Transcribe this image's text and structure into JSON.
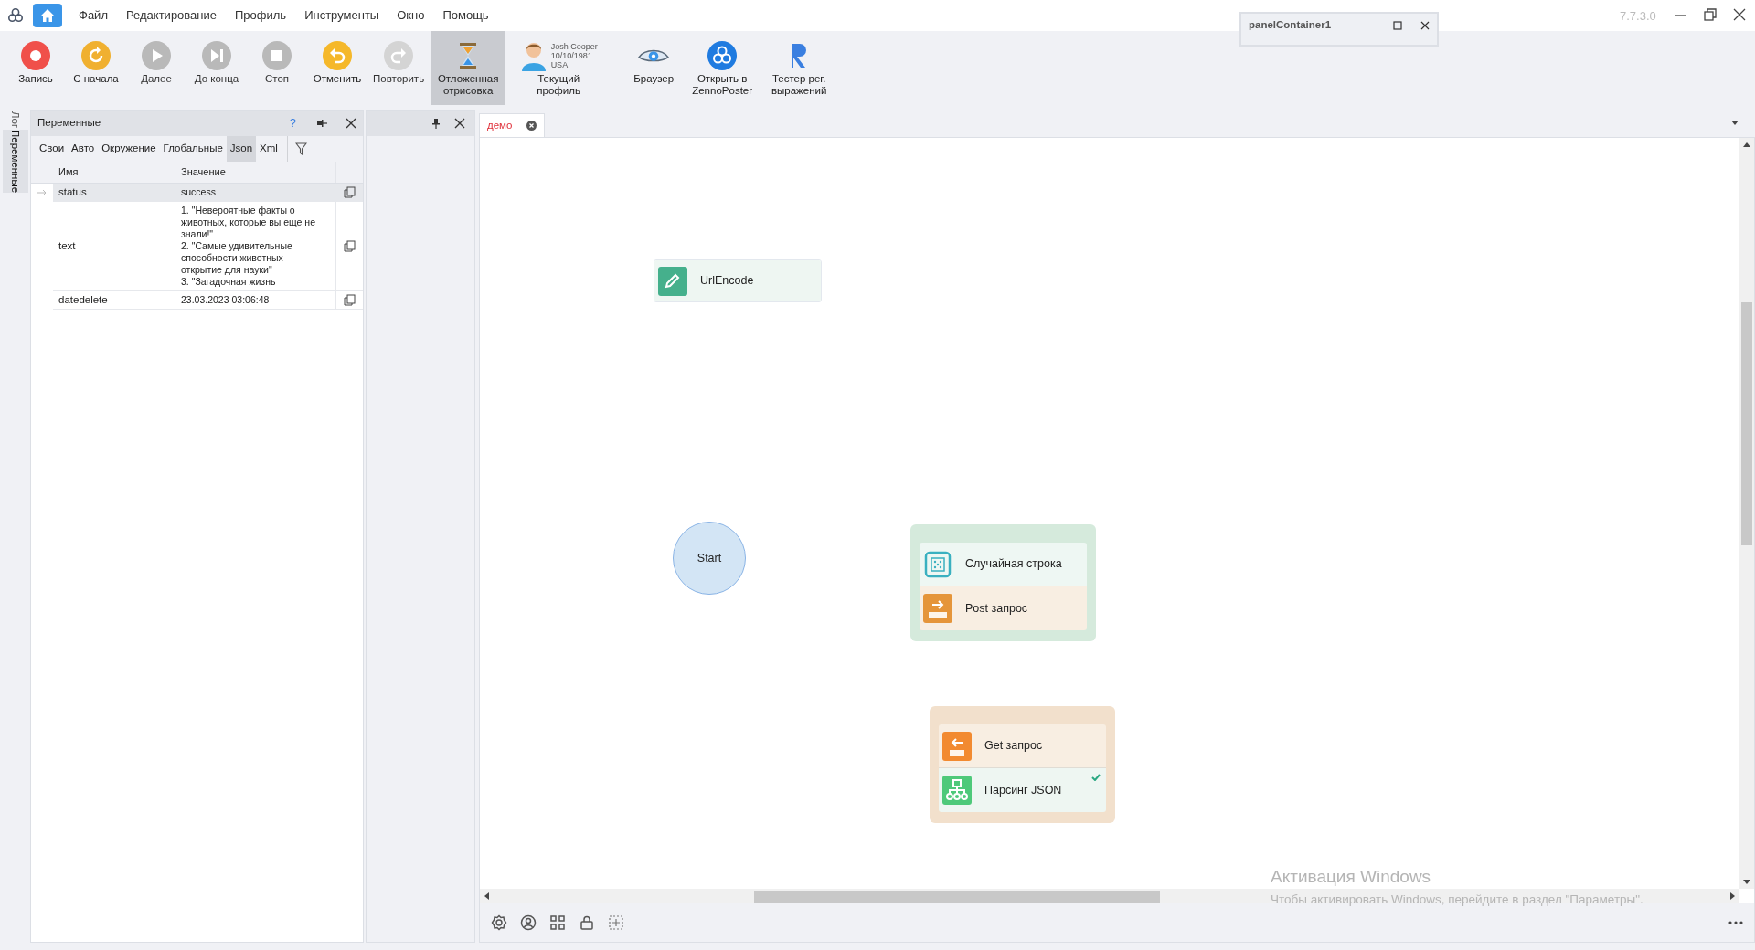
{
  "app": {
    "version": "7.7.3.0"
  },
  "menu": [
    {
      "label": "Файл"
    },
    {
      "label": "Редактирование"
    },
    {
      "label": "Профиль"
    },
    {
      "label": "Инструменты"
    },
    {
      "label": "Окно"
    },
    {
      "label": "Помощь"
    }
  ],
  "toolbar": [
    {
      "kind": "record",
      "label": "Запись",
      "disabled": false,
      "selected": false
    },
    {
      "kind": "restart",
      "label": "С начала",
      "disabled": false,
      "selected": false
    },
    {
      "kind": "play",
      "label": "Далее",
      "disabled": true,
      "selected": false
    },
    {
      "kind": "end",
      "label": "До конца",
      "disabled": true,
      "selected": false
    },
    {
      "kind": "stop",
      "label": "Стоп",
      "disabled": true,
      "selected": false
    },
    {
      "kind": "undo",
      "label": "Отменить",
      "disabled": false,
      "selected": false
    },
    {
      "kind": "redo",
      "label": "Повторить",
      "disabled": true,
      "selected": false
    },
    {
      "kind": "hourglass",
      "label": "Отложенная отрисовка",
      "disabled": false,
      "selected": true
    },
    {
      "kind": "profile",
      "label": "Текущий профиль",
      "disabled": false,
      "selected": false,
      "lines": [
        "Josh Cooper",
        "10/10/1981",
        "USA"
      ]
    },
    {
      "kind": "eye",
      "label": "Браузер",
      "disabled": false,
      "selected": false
    },
    {
      "kind": "logo",
      "label": "Открыть в ZennoPoster",
      "disabled": false,
      "selected": false
    },
    {
      "kind": "regex",
      "label": "Тестер рег. выражений",
      "disabled": false,
      "selected": false
    }
  ],
  "floating_panel": {
    "title": "panelContainer1"
  },
  "side_tabs": [
    {
      "label": "Лог",
      "selected": false
    },
    {
      "label": "Переменные",
      "selected": true
    }
  ],
  "variables_panel": {
    "title": "Переменные",
    "help": "?",
    "tabs": [
      {
        "label": "Свои",
        "selected": false
      },
      {
        "label": "Авто",
        "selected": false
      },
      {
        "label": "Окружение",
        "selected": false
      },
      {
        "label": "Глобальные",
        "selected": false
      },
      {
        "label": "Json",
        "selected": true
      },
      {
        "label": "Xml",
        "selected": false
      }
    ],
    "columns": [
      "Имя",
      "Значение"
    ],
    "rows": [
      {
        "name": "status",
        "value": "success",
        "selected": true
      },
      {
        "name": "text",
        "value": "1. \"Невероятные факты о животных, которые вы еще не знали!\"\n2. \"Самые удивительные способности животных – открытие для науки\"\n3. \"Загадочная жизнь",
        "selected": false
      },
      {
        "name": "datedelete",
        "value": "23.03.2023 03:06:48",
        "selected": false
      }
    ]
  },
  "document_tabs": [
    {
      "label": "демо",
      "selected": true
    }
  ],
  "canvas": {
    "nodes": [
      {
        "kind": "action",
        "items": [
          {
            "kind": "pencil",
            "label": "UrlEncode",
            "checked": false
          }
        ]
      },
      {
        "kind": "start",
        "label": "Start"
      },
      {
        "kind": "group",
        "color": "#d5eadc",
        "items": [
          {
            "kind": "dice",
            "label": "Случайная строка",
            "checked": false
          },
          {
            "kind": "post",
            "label": "Post запрос",
            "checked": false
          }
        ]
      },
      {
        "kind": "group",
        "color": "#f2e0cc",
        "items": [
          {
            "kind": "get",
            "label": "Get запрос",
            "checked": false
          },
          {
            "kind": "tree",
            "label": "Парсинг JSON",
            "checked": true
          }
        ]
      }
    ]
  },
  "activation": {
    "title": "Активация Windows",
    "text": "Чтобы активировать Windows, перейдите в раздел \"Параметры\"."
  }
}
